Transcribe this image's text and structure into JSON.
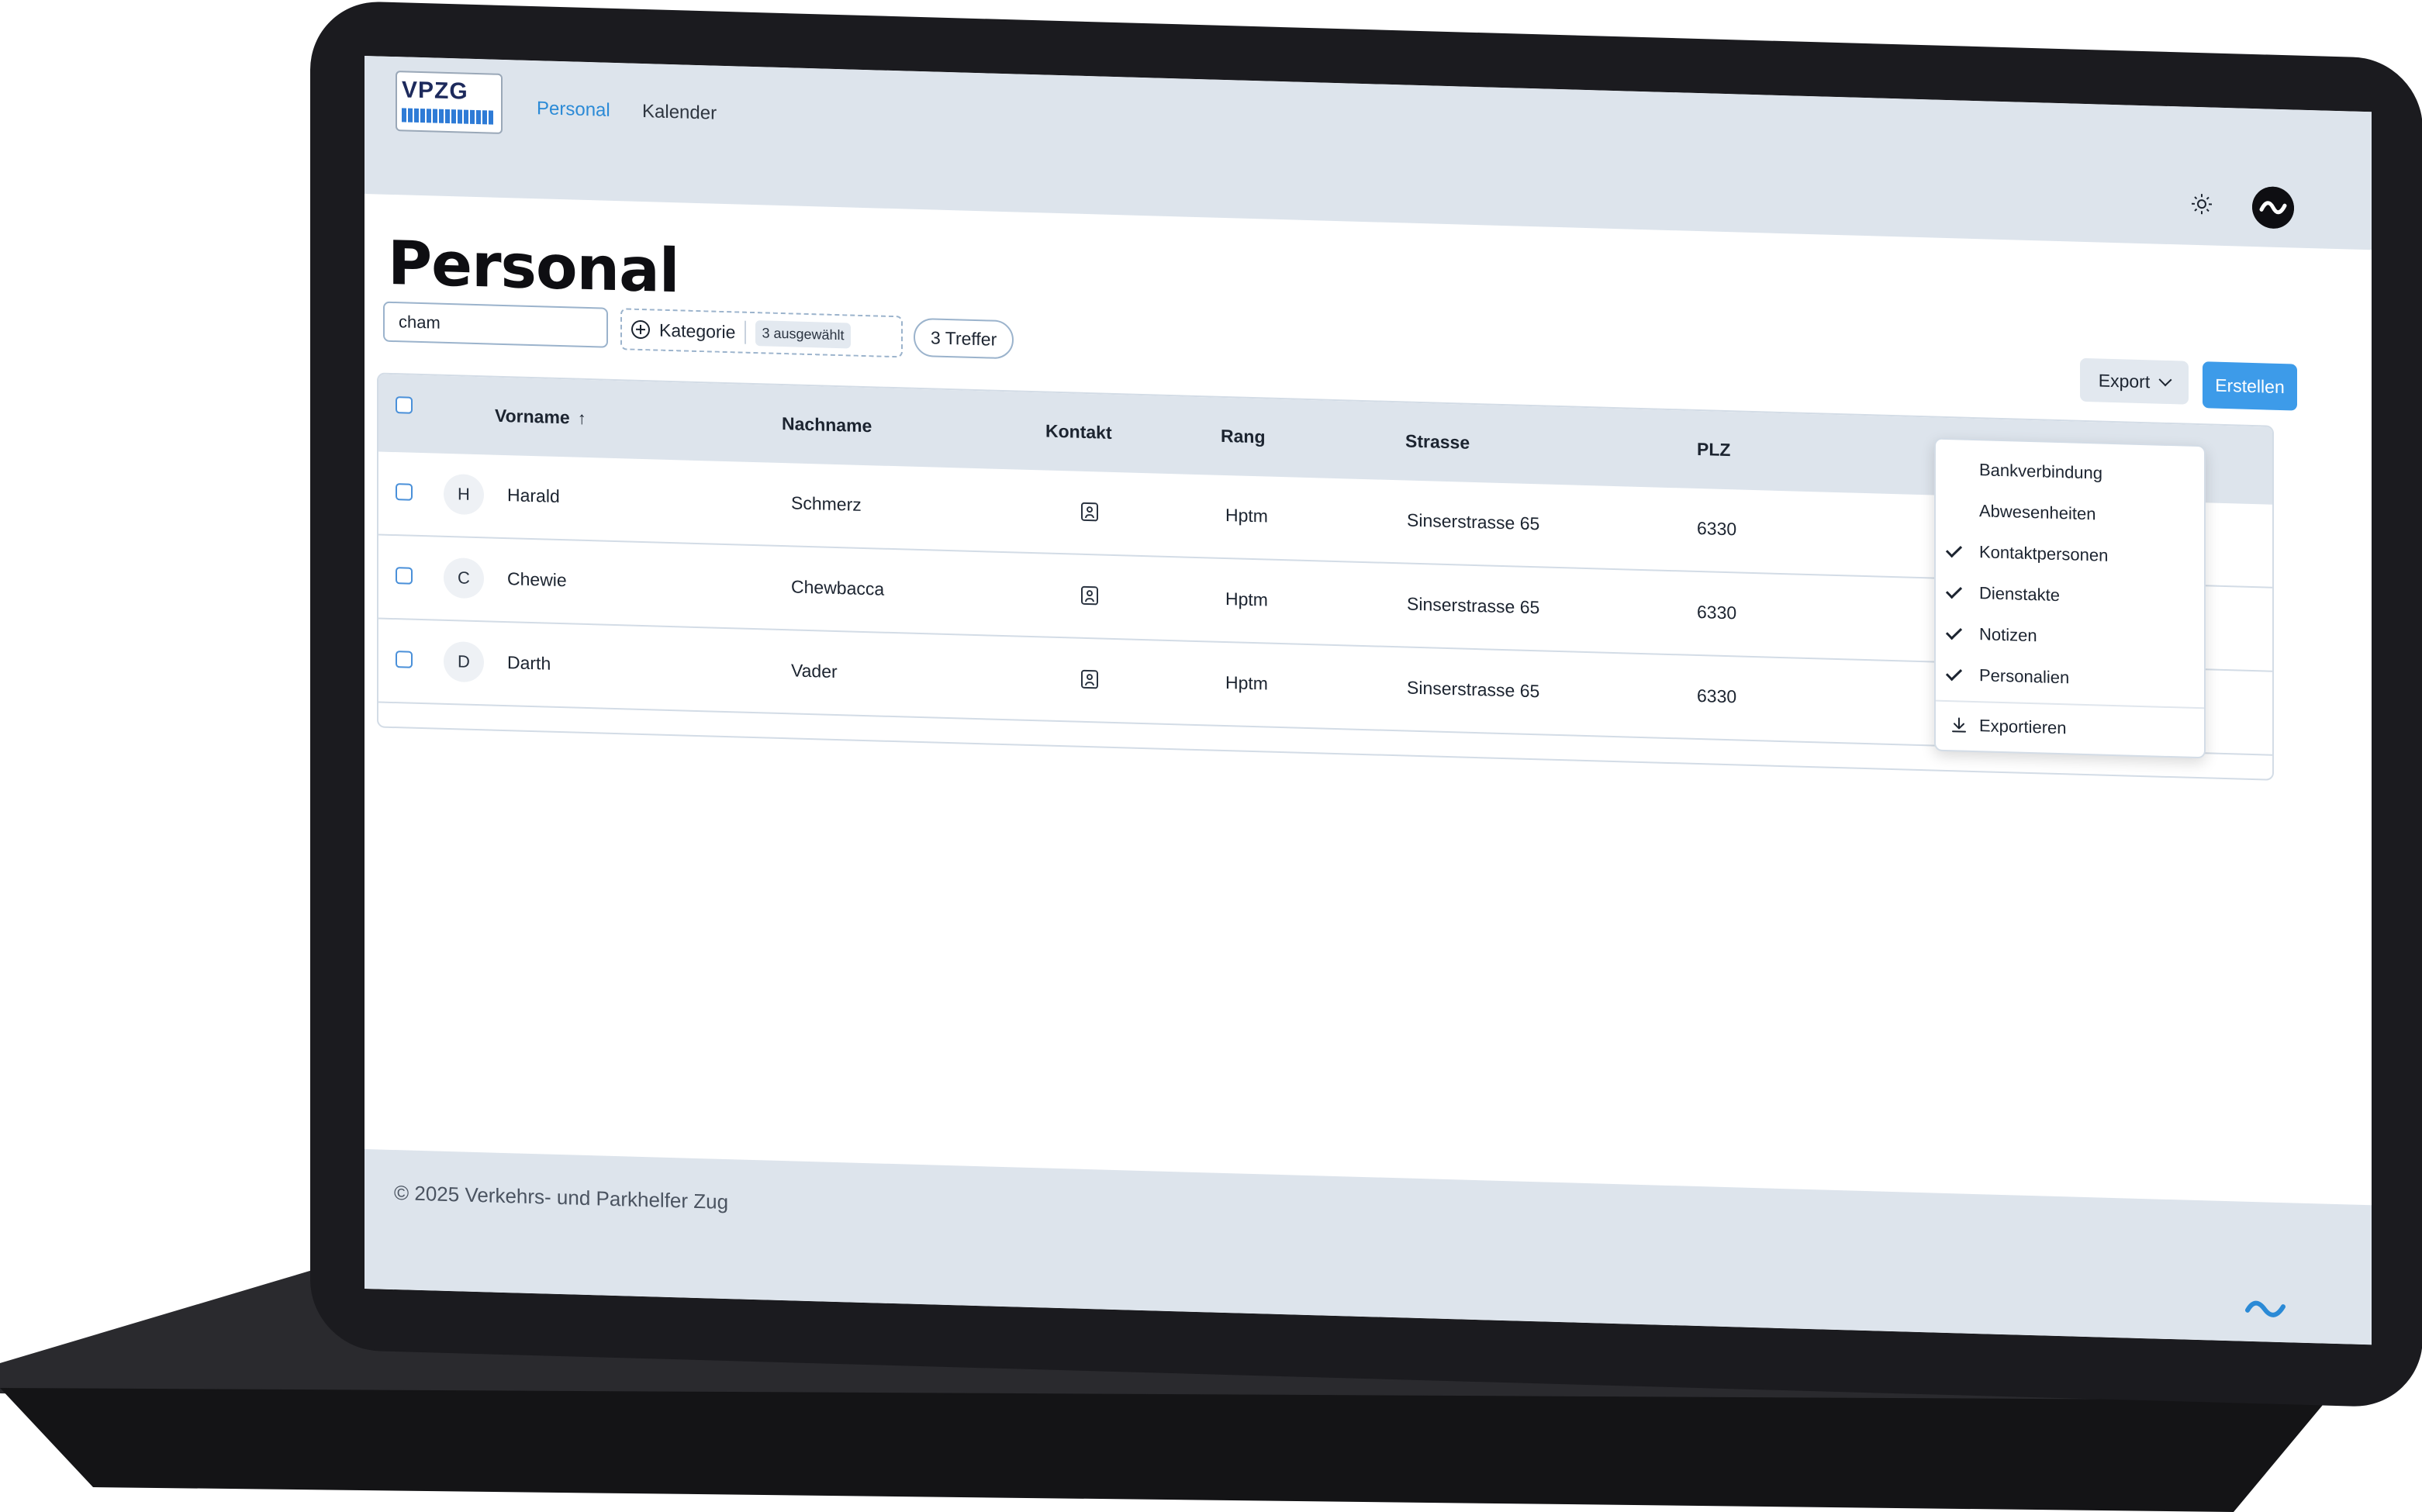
{
  "logo": {
    "text": "VPZG"
  },
  "nav": {
    "items": [
      {
        "label": "Personal",
        "active": true
      },
      {
        "label": "Kalender",
        "active": false
      }
    ]
  },
  "header_icons": [
    "sun-icon",
    "user-avatar"
  ],
  "page": {
    "title": "Personal"
  },
  "filters": {
    "search_value": "cham",
    "category_label": "Kategorie",
    "category_badge": "3 ausgewählt",
    "results": "3 Treffer"
  },
  "actions": {
    "export_label": "Export",
    "create_label": "Erstellen"
  },
  "table": {
    "columns": [
      "Vorname",
      "Nachname",
      "Kontakt",
      "Rang",
      "Strasse",
      "PLZ"
    ],
    "sort_column": "Vorname",
    "rows": [
      {
        "initial": "H",
        "vorname": "Harald",
        "nachname": "Schmerz",
        "rang": "Hptm",
        "strasse": "Sinserstrasse 65",
        "plz": "6330"
      },
      {
        "initial": "C",
        "vorname": "Chewie",
        "nachname": "Chewbacca",
        "rang": "Hptm",
        "strasse": "Sinserstrasse 65",
        "plz": "6330"
      },
      {
        "initial": "D",
        "vorname": "Darth",
        "nachname": "Vader",
        "rang": "Hptm",
        "strasse": "Sinserstrasse 65",
        "plz": "6330"
      }
    ]
  },
  "export_menu": {
    "items": [
      {
        "label": "Bankverbindung",
        "checked": false
      },
      {
        "label": "Abwesenheiten",
        "checked": false
      },
      {
        "label": "Kontaktpersonen",
        "checked": true
      },
      {
        "label": "Dienstakte",
        "checked": true
      },
      {
        "label": "Notizen",
        "checked": true
      },
      {
        "label": "Personalien",
        "checked": true
      }
    ],
    "action_label": "Exportieren"
  },
  "footer": {
    "text": "© 2025 Verkehrs- und Parkhelfer Zug"
  },
  "colors": {
    "accent": "#3d9be9",
    "nav_bg": "#dde4ec",
    "laptop": "#1b1b1f"
  }
}
